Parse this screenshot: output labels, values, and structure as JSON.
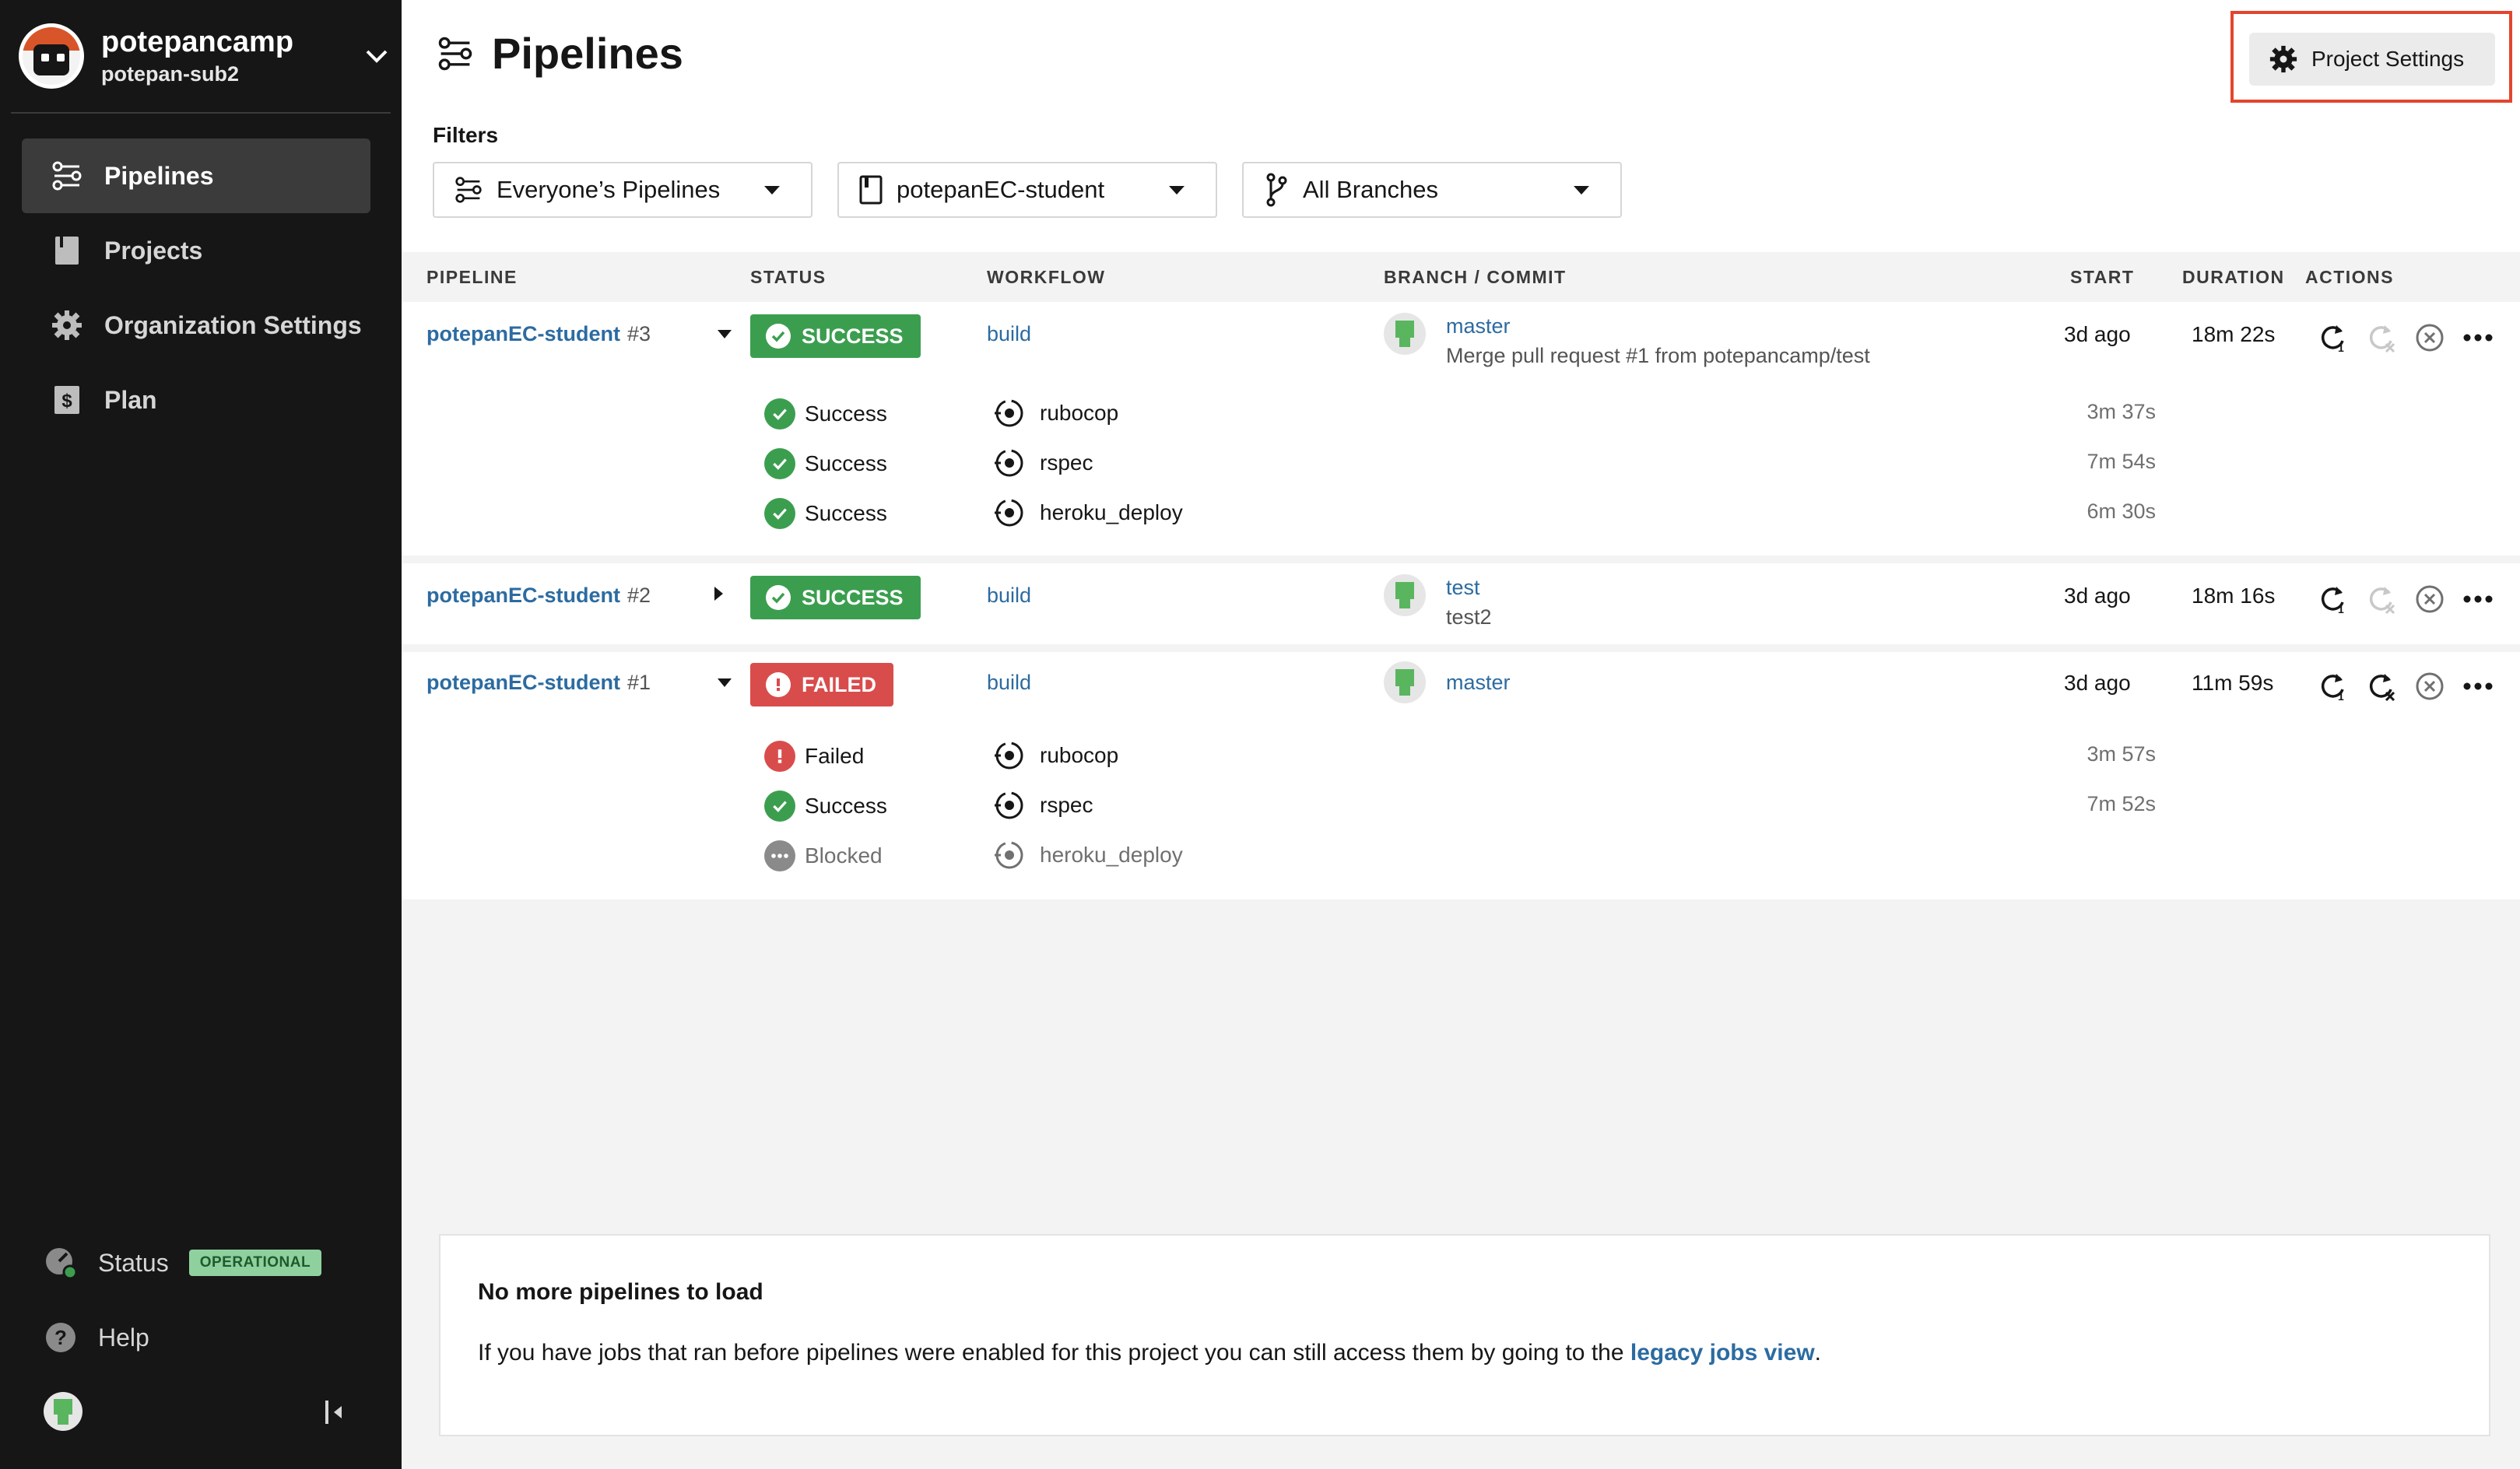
{
  "org": {
    "name": "potepancamp",
    "sub": "potepan-sub2"
  },
  "nav": [
    {
      "label": "Pipelines",
      "icon": "pipelines-icon",
      "active": true
    },
    {
      "label": "Projects",
      "icon": "projects-icon"
    },
    {
      "label": "Organization Settings",
      "icon": "gear-icon"
    },
    {
      "label": "Plan",
      "icon": "dollar-icon"
    }
  ],
  "sidebar_bottom": {
    "status_label": "Status",
    "status_badge": "OPERATIONAL",
    "help_label": "Help"
  },
  "header": {
    "title": "Pipelines",
    "project_settings": "Project Settings"
  },
  "filters": {
    "label": "Filters",
    "pipelines": "Everyone’s Pipelines",
    "project": "potepanEC-student",
    "branches": "All Branches"
  },
  "table": {
    "headers": {
      "pipeline": "PIPELINE",
      "status": "STATUS",
      "workflow": "WORKFLOW",
      "branch_commit": "BRANCH / COMMIT",
      "start": "START",
      "duration": "DURATION",
      "actions": "ACTIONS"
    },
    "rows": [
      {
        "project": "potepanEC-student",
        "number": "#3",
        "expanded": true,
        "status": "SUCCESS",
        "workflow": "build",
        "branch": "master",
        "commit": "Merge pull request #1 from potepancamp/test",
        "start": "3d ago",
        "duration": "18m 22s",
        "jobs": [
          {
            "status": "Success",
            "name": "rubocop",
            "duration": "3m 37s"
          },
          {
            "status": "Success",
            "name": "rspec",
            "duration": "7m 54s"
          },
          {
            "status": "Success",
            "name": "heroku_deploy",
            "duration": "6m 30s"
          }
        ]
      },
      {
        "project": "potepanEC-student",
        "number": "#2",
        "expanded": false,
        "status": "SUCCESS",
        "workflow": "build",
        "branch": "test",
        "commit": "test2",
        "start": "3d ago",
        "duration": "18m 16s"
      },
      {
        "project": "potepanEC-student",
        "number": "#1",
        "expanded": true,
        "status": "FAILED",
        "workflow": "build",
        "branch": "master",
        "commit": "",
        "start": "3d ago",
        "duration": "11m 59s",
        "jobs": [
          {
            "status": "Failed",
            "name": "rubocop",
            "duration": "3m 57s"
          },
          {
            "status": "Success",
            "name": "rspec",
            "duration": "7m 52s"
          },
          {
            "status": "Blocked",
            "name": "heroku_deploy",
            "duration": ""
          }
        ]
      }
    ]
  },
  "empty": {
    "title": "No more pipelines to load",
    "text": "If you have jobs that ran before pipelines were enabled for this project you can still access them by going to the",
    "link": "legacy jobs view",
    "suffix": "."
  },
  "colors": {
    "success": "#3b9e4f",
    "failed": "#d94c4c",
    "link": "#2c6ba1",
    "sidebar": "#161616",
    "highlight": "#e3452d"
  }
}
